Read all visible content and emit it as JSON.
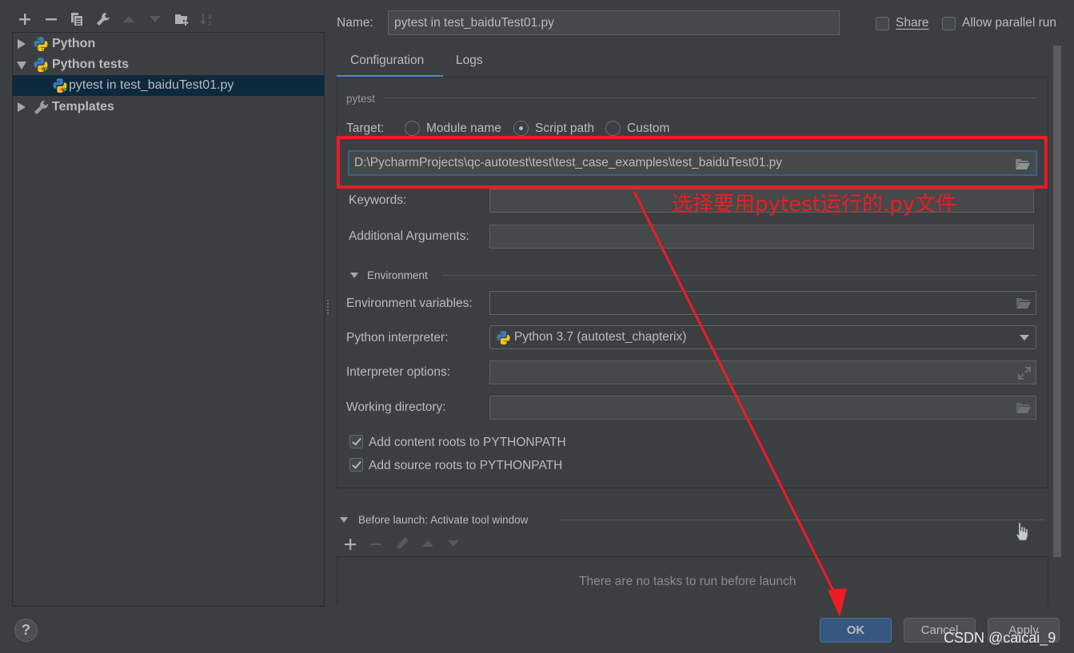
{
  "toolbar": {
    "icons": [
      "add-icon",
      "remove-icon",
      "copy-icon",
      "wrench-icon",
      "move-up-icon",
      "move-down-icon",
      "new-folder-icon",
      "sort-alpha-icon"
    ]
  },
  "tree": {
    "items": [
      {
        "label": "Python",
        "expanded": false,
        "icon": "python-icon"
      },
      {
        "label": "Python tests",
        "expanded": true,
        "icon": "python-tests-icon"
      },
      {
        "label": "pytest in test_baiduTest01.py",
        "selected": true,
        "icon": "pytest-icon"
      },
      {
        "label": "Templates",
        "expanded": false,
        "icon": "wrench-icon"
      }
    ]
  },
  "header": {
    "name_label": "Name:",
    "name_value": "pytest in test_baiduTest01.py",
    "share_label": "Share",
    "share_checked": false,
    "parallel_label": "Allow parallel run",
    "parallel_checked": false
  },
  "tabs": [
    {
      "label": "Configuration",
      "active": true
    },
    {
      "label": "Logs",
      "active": false
    }
  ],
  "config": {
    "section_title": "pytest",
    "target_label": "Target:",
    "target_options": [
      {
        "label": "Module name",
        "selected": false
      },
      {
        "label": "Script path",
        "selected": true
      },
      {
        "label": "Custom",
        "selected": false
      }
    ],
    "script_path": "D:\\PycharmProjects\\qc-autotest\\test\\test_case_examples\\test_baiduTest01.py",
    "keywords_label": "Keywords:",
    "keywords_value": "",
    "additional_args_label": "Additional Arguments:",
    "additional_args_value": "",
    "environment_title": "Environment",
    "env_vars_label": "Environment variables:",
    "env_vars_value": "",
    "interpreter_label": "Python interpreter:",
    "interpreter_value": "Python 3.7 (autotest_chapterix)",
    "interp_options_label": "Interpreter options:",
    "interp_options_value": "",
    "working_dir_label": "Working directory:",
    "working_dir_value": "",
    "content_roots_label": "Add content roots to PYTHONPATH",
    "content_roots_checked": true,
    "source_roots_label": "Add source roots to PYTHONPATH",
    "source_roots_checked": true
  },
  "before_launch": {
    "title": "Before launch: Activate tool window",
    "empty_text": "There are no tasks to run before launch"
  },
  "buttons": {
    "ok": "OK",
    "cancel": "Cancel",
    "apply": "Apply",
    "help": "?"
  },
  "annotation": {
    "text": "选择要用pytest运行的.py文件",
    "color": "#ed1c24"
  },
  "watermark": "CSDN @caicai_9"
}
